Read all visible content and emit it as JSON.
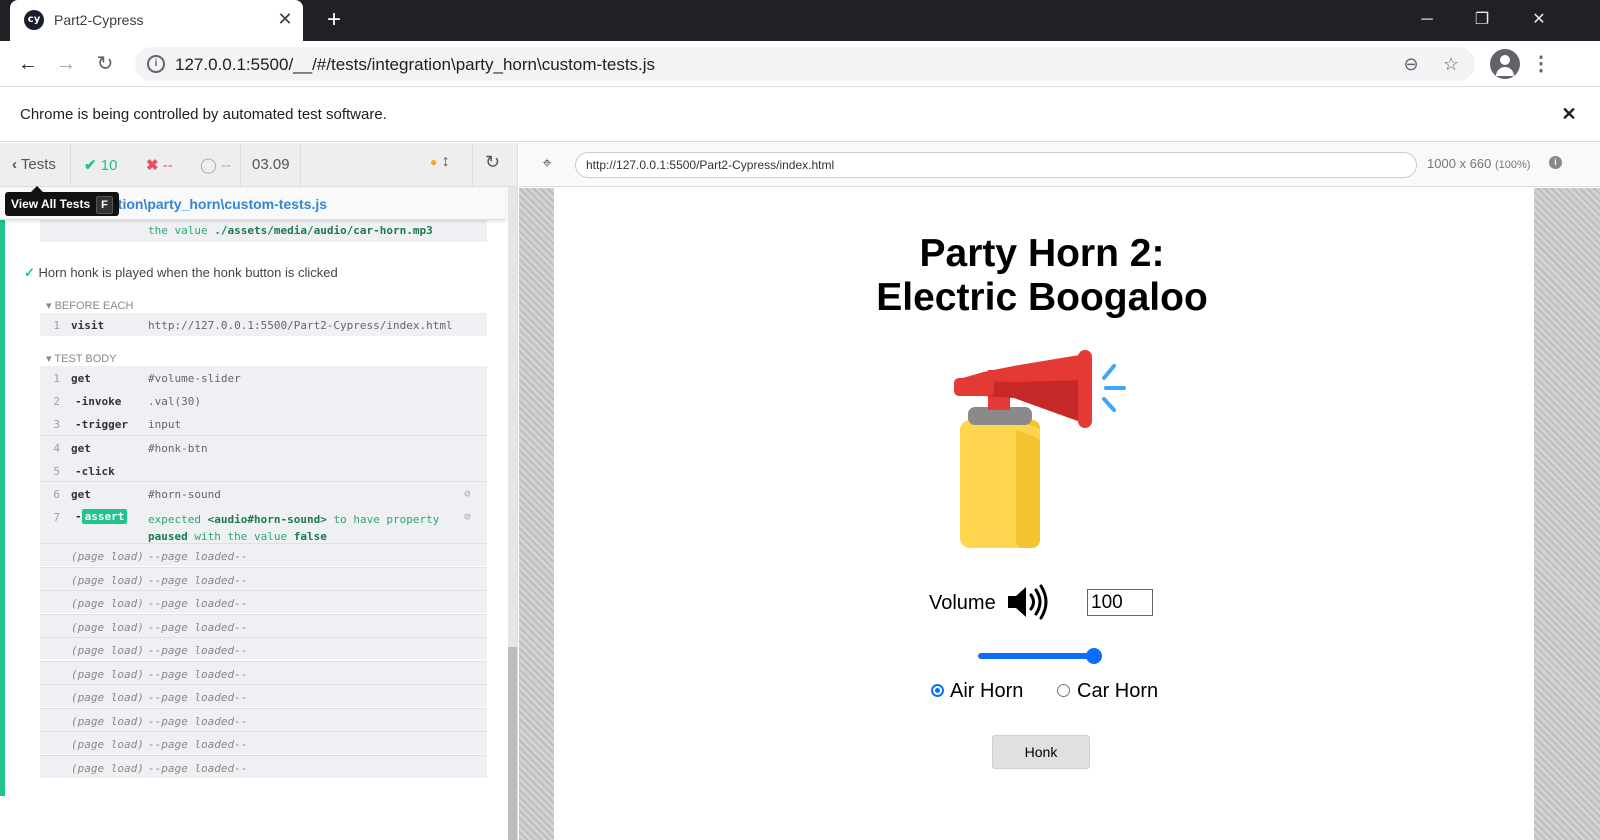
{
  "browser": {
    "tab_title": "Part2-Cypress",
    "tab_favicon_text": "cy",
    "address_url": "127.0.0.1:5500/__/#/tests/integration\\party_horn\\custom-tests.js",
    "infobar_text": "Chrome is being controlled by automated test software."
  },
  "reporter": {
    "tests_label": "Tests",
    "passed_count": "10",
    "failed_count": "--",
    "pending_count": "--",
    "duration": "03.09",
    "tooltip_label": "View All Tests",
    "tooltip_key": "F",
    "spec_path": "ation\\party_horn\\custom-tests.js",
    "prev_tail_prefix": "the value",
    "prev_tail_value": "./assets/media/audio/car-horn.mp3",
    "test_title": "Horn honk is played when the honk button is clicked",
    "before_each_label": "BEFORE EACH",
    "test_body_label": "TEST BODY",
    "before_each_cmd": {
      "num": "1",
      "name": "visit",
      "msg": "http://127.0.0.1:5500/Part2-Cypress/index.html"
    },
    "commands": [
      {
        "num": "1",
        "name": "get",
        "msg": "#volume-slider"
      },
      {
        "num": "2",
        "name": "-invoke",
        "msg": ".val(30)"
      },
      {
        "num": "3",
        "name": "-trigger",
        "msg": "input"
      },
      {
        "num": "4",
        "name": "get",
        "msg": "#honk-btn"
      },
      {
        "num": "5",
        "name": "-click",
        "msg": ""
      },
      {
        "num": "6",
        "name": "get",
        "msg": "#horn-sound"
      }
    ],
    "assert_cmd": {
      "num": "7",
      "prefix": "-",
      "badge": "assert",
      "expected": "expected",
      "subject": "<audio#horn-sound>",
      "to_have": "to have property",
      "prop": "paused",
      "with_value": "with the value",
      "value": "false"
    },
    "page_loads": [
      {
        "name": "(page load)",
        "msg": "--page loaded--"
      },
      {
        "name": "(page load)",
        "msg": "--page loaded--"
      },
      {
        "name": "(page load)",
        "msg": "--page loaded--"
      },
      {
        "name": "(page load)",
        "msg": "--page loaded--"
      },
      {
        "name": "(page load)",
        "msg": "--page loaded--"
      },
      {
        "name": "(page load)",
        "msg": "--page loaded--"
      },
      {
        "name": "(page load)",
        "msg": "--page loaded--"
      },
      {
        "name": "(page load)",
        "msg": "--page loaded--"
      },
      {
        "name": "(page load)",
        "msg": "--page loaded--"
      },
      {
        "name": "(page load)",
        "msg": "--page loaded--"
      }
    ]
  },
  "aut": {
    "url": "http://127.0.0.1:5500/Part2-Cypress/index.html",
    "viewport_size": "1000 x 660",
    "viewport_scale": "(100%)"
  },
  "app": {
    "title_line1": "Party Horn 2:",
    "title_line2": "Electric Boogaloo",
    "volume_label": "Volume",
    "volume_value": "100",
    "slider_value_percent": 100,
    "radio_air": "Air Horn",
    "radio_car": "Car Horn",
    "selected_horn": "Air Horn",
    "honk_label": "Honk"
  },
  "colors": {
    "pass_green": "#1fc48a",
    "accent_blue": "#0d6efd",
    "fail_red": "#e94f5f",
    "pending_orange": "#f5a623"
  }
}
